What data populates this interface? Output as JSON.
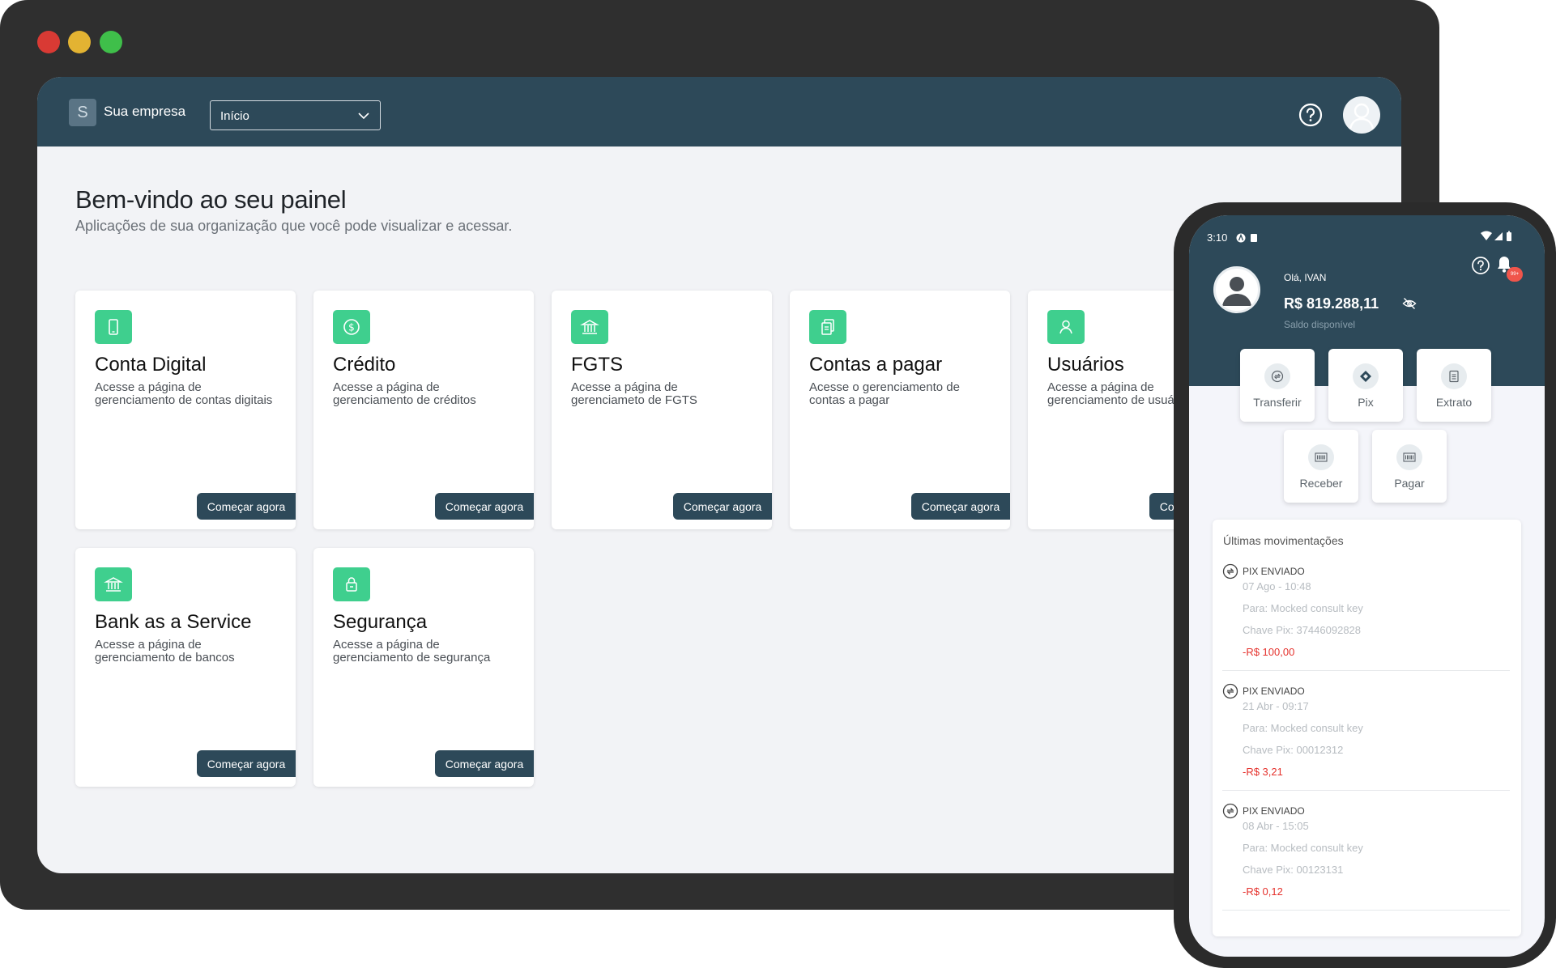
{
  "header": {
    "brand_initial": "S",
    "brand_name": "Sua empresa",
    "nav_selected": "Início"
  },
  "welcome": {
    "title": "Bem-vindo ao seu painel",
    "subtitle": "Aplicações de sua organização que você pode visualizar e acessar."
  },
  "cards": [
    {
      "title": "Conta Digital",
      "desc": "Acesse a página de gerenciamento de contas digitais",
      "button": "Começar agora",
      "icon": "phone-icon"
    },
    {
      "title": "Crédito",
      "desc": "Acesse a página de gerenciamento de créditos",
      "button": "Começar agora",
      "icon": "dollar-coin-icon"
    },
    {
      "title": "FGTS",
      "desc": "Acesse a página de gerenciameto de FGTS",
      "button": "Começar agora",
      "icon": "bank-icon"
    },
    {
      "title": "Contas a pagar",
      "desc": "Acesse o gerenciamento de contas a pagar",
      "button": "Começar agora",
      "icon": "documents-icon"
    },
    {
      "title": "Usuários",
      "desc": "Acesse a página de gerenciamento de usuários",
      "button": "Começar agora",
      "icon": "user-icon"
    },
    {
      "title": "Bank as a Service",
      "desc": "Acesse a página de gerenciamento de bancos",
      "button": "Começar agora",
      "icon": "bank-icon"
    },
    {
      "title": "Segurança",
      "desc": "Acesse a página de gerenciamento de segurança",
      "button": "Começar agora",
      "icon": "lock-icon"
    }
  ],
  "phone": {
    "status_time": "3:10",
    "greeting": "Olá, IVAN",
    "balance": "R$ 819.288,11",
    "balance_label": "Saldo disponível",
    "notification_badge": "99+",
    "actions": [
      {
        "label": "Transferir",
        "icon": "transfer-icon"
      },
      {
        "label": "Pix",
        "icon": "pix-icon"
      },
      {
        "label": "Extrato",
        "icon": "statement-icon"
      },
      {
        "label": "Receber",
        "icon": "barcode-icon"
      },
      {
        "label": "Pagar",
        "icon": "barcode-icon"
      }
    ],
    "feed_title": "Últimas movimentações",
    "movements": [
      {
        "type": "PIX ENVIADO",
        "date": "07 Ago - 10:48",
        "to": "Para: Mocked consult key",
        "key": "Chave Pix: 37446092828",
        "value": "-R$ 100,00"
      },
      {
        "type": "PIX ENVIADO",
        "date": "21 Abr - 09:17",
        "to": "Para: Mocked consult key",
        "key": "Chave Pix: 00012312",
        "value": "-R$ 3,21"
      },
      {
        "type": "PIX ENVIADO",
        "date": "08 Abr - 15:05",
        "to": "Para: Mocked consult key",
        "key": "Chave Pix: 00123131",
        "value": "-R$ 0,12"
      }
    ]
  },
  "colors": {
    "primary": "#2d4959",
    "accent": "#3fcf8e",
    "negative": "#e5322d",
    "background": "#f2f3f6"
  }
}
